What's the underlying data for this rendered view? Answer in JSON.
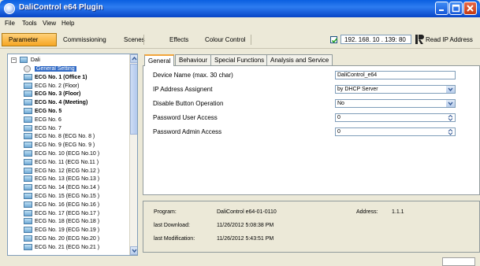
{
  "window": {
    "title": "DaliControl e64 Plugin"
  },
  "menu": [
    "File",
    "Tools",
    "View",
    "Help"
  ],
  "toolbar": {
    "tabs": [
      "Parameter",
      "Commissioning",
      "Scenes",
      "Effects",
      "Colour Control"
    ],
    "active_tab": "Parameter",
    "ip_checked": true,
    "ip_address": "192. 168. 10 . 139: 80",
    "read_ip_label": "Read IP Address"
  },
  "tree": {
    "root": "Dali",
    "items": [
      {
        "label": "General Setting",
        "bold": false,
        "selected": true,
        "icon": "gear-icon"
      },
      {
        "label": "ECG No. 1 (Office 1)",
        "bold": true,
        "icon": "ecg-icon"
      },
      {
        "label": "ECG No. 2 (Floor)",
        "bold": false,
        "icon": "ecg-icon"
      },
      {
        "label": "ECG No. 3 (Floor)",
        "bold": true,
        "icon": "ecg-icon"
      },
      {
        "label": "ECG No. 4 (Meeting)",
        "bold": true,
        "icon": "ecg-icon"
      },
      {
        "label": "ECG No. 5",
        "bold": true,
        "icon": "ecg-icon"
      },
      {
        "label": "ECG No. 6",
        "bold": false,
        "icon": "ecg-icon"
      },
      {
        "label": "ECG No. 7",
        "bold": false,
        "icon": "ecg-edit-icon"
      },
      {
        "label": "ECG No. 8 (ECG No. 8 )",
        "bold": false,
        "icon": "ecg-icon"
      },
      {
        "label": "ECG No. 9 (ECG No. 9 )",
        "bold": false,
        "icon": "ecg-icon"
      },
      {
        "label": "ECG No. 10 (ECG No.10 )",
        "bold": false,
        "icon": "ecg-icon"
      },
      {
        "label": "ECG No. 11 (ECG No.11 )",
        "bold": false,
        "icon": "ecg-icon"
      },
      {
        "label": "ECG No. 12 (ECG No.12 )",
        "bold": false,
        "icon": "ecg-icon"
      },
      {
        "label": "ECG No. 13 (ECG No.13 )",
        "bold": false,
        "icon": "ecg-icon"
      },
      {
        "label": "ECG No. 14 (ECG No.14 )",
        "bold": false,
        "icon": "ecg-icon"
      },
      {
        "label": "ECG No. 15 (ECG No.15 )",
        "bold": false,
        "icon": "ecg-icon"
      },
      {
        "label": "ECG No. 16 (ECG No.16 )",
        "bold": false,
        "icon": "ecg-icon"
      },
      {
        "label": "ECG No. 17 (ECG No.17 )",
        "bold": false,
        "icon": "ecg-icon"
      },
      {
        "label": "ECG No. 18 (ECG No.18 )",
        "bold": false,
        "icon": "ecg-icon"
      },
      {
        "label": "ECG No. 19 (ECG No.19 )",
        "bold": false,
        "icon": "ecg-icon"
      },
      {
        "label": "ECG No. 20 (ECG No.20 )",
        "bold": false,
        "icon": "ecg-icon"
      },
      {
        "label": "ECG No. 21 (ECG No.21 )",
        "bold": false,
        "icon": "ecg-icon"
      }
    ]
  },
  "settings_tabs": [
    "General",
    "Behaviour",
    "Special Functions",
    "Analysis and Service"
  ],
  "settings": [
    {
      "label": "Device Name (max. 30 char)",
      "value": "DaliControl_e64",
      "control": "text"
    },
    {
      "label": "IP Address Assignent",
      "value": "by DHCP Server",
      "control": "dropdown"
    },
    {
      "label": "Disable Button Operation",
      "value": "No",
      "control": "dropdown"
    },
    {
      "label": "Password User Access",
      "value": "0",
      "control": "spinner"
    },
    {
      "label": "Password Admin Access",
      "value": "0",
      "control": "spinner"
    }
  ],
  "info": {
    "program_label": "Program:",
    "program_value": "DaliControl  e64-01-0110",
    "address_label": "Address:",
    "address_value": "1.1.1",
    "last_download_label": "last Download:",
    "last_download_value": "11/26/2012 5:08:38 PM",
    "last_modification_label": "last Modification:",
    "last_modification_value": "11/26/2012 5:43:51 PM"
  }
}
